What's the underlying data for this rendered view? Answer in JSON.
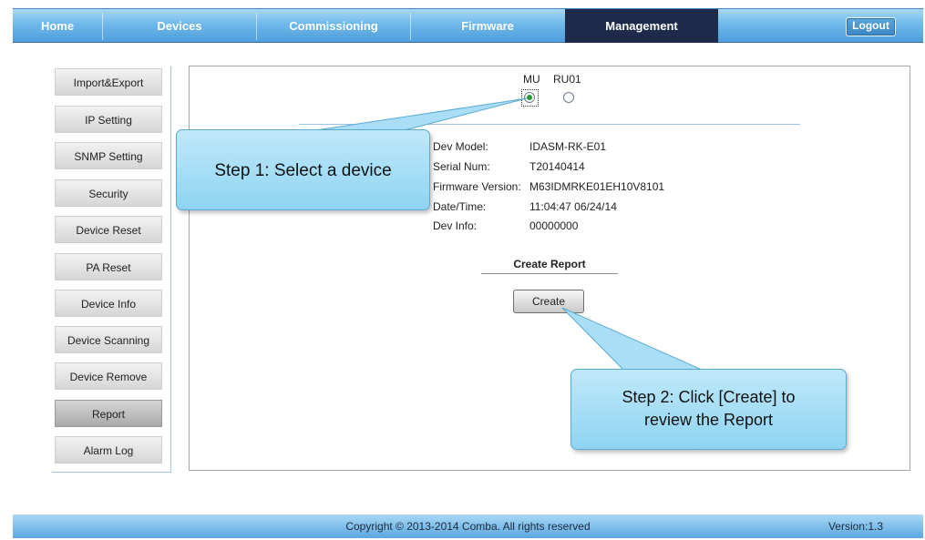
{
  "nav": {
    "tabs": [
      {
        "label": "Home"
      },
      {
        "label": "Devices"
      },
      {
        "label": "Commissioning"
      },
      {
        "label": "Firmware"
      },
      {
        "label": "Management"
      }
    ],
    "logout_label": "Logout"
  },
  "menu": {
    "items": [
      {
        "label": "Import&Export"
      },
      {
        "label": "IP Setting"
      },
      {
        "label": "SNMP Setting"
      },
      {
        "label": "Security"
      },
      {
        "label": "Device Reset"
      },
      {
        "label": "PA Reset"
      },
      {
        "label": "Device Info"
      },
      {
        "label": "Device Scanning"
      },
      {
        "label": "Device Remove"
      },
      {
        "label": "Report"
      },
      {
        "label": "Alarm Log"
      }
    ],
    "active": "Report"
  },
  "device_select": {
    "options": [
      {
        "label": "MU",
        "selected": true
      },
      {
        "label": "RU01",
        "selected": false
      }
    ]
  },
  "device_info": [
    {
      "key": "Dev Model:",
      "value": "IDASM-RK-E01"
    },
    {
      "key": "Serial Num:",
      "value": "T20140414"
    },
    {
      "key": "Firmware Version:",
      "value": "M63IDMRKE01EH10V8101"
    },
    {
      "key": "Date/Time:",
      "value": "11:04:47 06/24/14"
    },
    {
      "key": "Dev Info:",
      "value": "00000000"
    }
  ],
  "report": {
    "title": "Create Report",
    "create_label": "Create"
  },
  "callouts": {
    "step1": "Step 1: Select a device",
    "step2_line1": "Step 2: Click [Create] to",
    "step2_line2": "review the Report"
  },
  "footer": {
    "copyright": "Copyright © 2013-2014 Comba. All rights reserved",
    "version": "Version:1.3"
  },
  "colors": {
    "nav_blue": "#6fb8ea",
    "active_tab": "#1d2a4a",
    "callout_fill": "#9fdaf4",
    "radio_checked": "#2d9a2d"
  }
}
